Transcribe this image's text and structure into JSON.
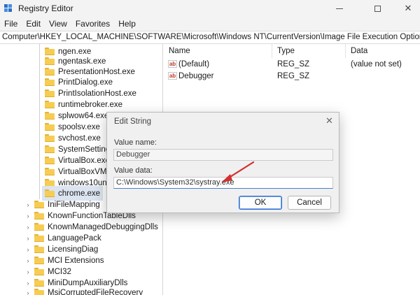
{
  "window": {
    "title": "Registry Editor"
  },
  "menu": [
    "File",
    "Edit",
    "View",
    "Favorites",
    "Help"
  ],
  "address": "Computer\\HKEY_LOCAL_MACHINE\\SOFTWARE\\Microsoft\\Windows NT\\CurrentVersion\\Image File Execution Options\\chrome.exe",
  "tree": {
    "children": [
      "ngen.exe",
      "ngentask.exe",
      "PresentationHost.exe",
      "PrintDialog.exe",
      "PrintIsolationHost.exe",
      "runtimebroker.exe",
      "splwow64.exe",
      "spoolsv.exe",
      "svchost.exe",
      "SystemSettings",
      "VirtualBox.exe",
      "VirtualBoxVM.e",
      "windows10univ",
      "chrome.exe"
    ],
    "siblings": [
      "IniFileMapping",
      "KnownFunctionTableDlls",
      "KnownManagedDebuggingDlls",
      "LanguagePack",
      "LicensingDiag",
      "MCI Extensions",
      "MCI32",
      "MiniDumpAuxiliaryDlls",
      "MsiCorruptedFileRecovery"
    ],
    "selected": "chrome.exe"
  },
  "list": {
    "headers": {
      "name": "Name",
      "type": "Type",
      "data": "Data"
    },
    "rows": [
      {
        "name": "(Default)",
        "type": "REG_SZ",
        "data": "(value not set)"
      },
      {
        "name": "Debugger",
        "type": "REG_SZ",
        "data": ""
      }
    ]
  },
  "dialog": {
    "title": "Edit String",
    "value_name_label": "Value name:",
    "value_name": "Debugger",
    "value_data_label": "Value data:",
    "value_data": "C:\\Windows\\System32\\systray.exe",
    "ok": "OK",
    "cancel": "Cancel"
  },
  "colors": {
    "arrow": "#d32f2f",
    "selection": "#dbe4f0",
    "folder": "#f6cd52"
  }
}
